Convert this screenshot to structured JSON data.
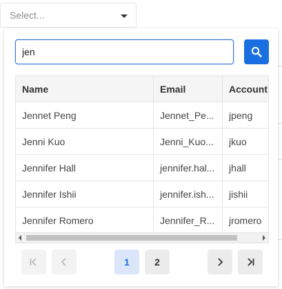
{
  "select": {
    "placeholder": "Select..."
  },
  "search": {
    "value": "jen",
    "button_icon": "search-icon"
  },
  "table": {
    "columns": [
      "Name",
      "Email",
      "Account"
    ],
    "rows": [
      [
        "Jennet Peng",
        "Jennet_Pe...",
        "jpeng"
      ],
      [
        "Jenni Kuo",
        "Jenni_Kuo...",
        "jkuo"
      ],
      [
        "Jennifer Hall",
        "jennifer.hal...",
        "jhall"
      ],
      [
        "Jennifer Ishii",
        "jennifer.ish...",
        "jishii"
      ],
      [
        "Jennifer Romero",
        "Jennifer_R...",
        "jromero"
      ]
    ]
  },
  "pagination": {
    "pages": [
      "1",
      "2"
    ],
    "current_page": "1"
  },
  "colors": {
    "accent": "#1a6fe0",
    "active_page_bg": "#dbe6fb"
  }
}
